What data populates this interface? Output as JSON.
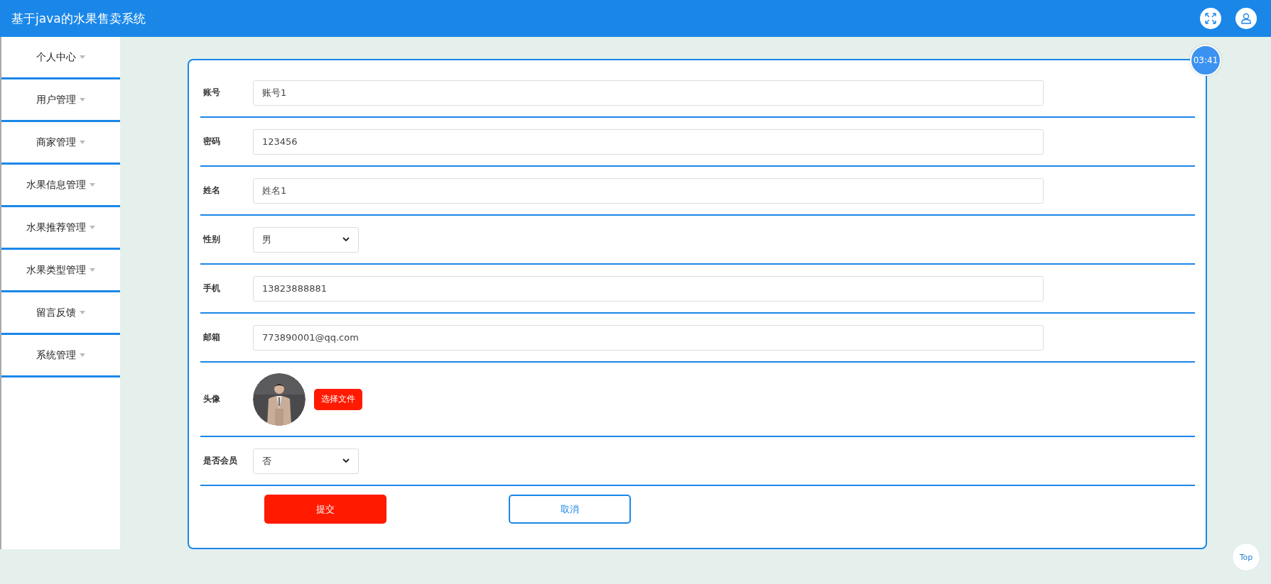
{
  "header": {
    "title": "基于java的水果售卖系统"
  },
  "sidebar": {
    "items": [
      {
        "label": "个人中心"
      },
      {
        "label": "用户管理"
      },
      {
        "label": "商家管理"
      },
      {
        "label": "水果信息管理"
      },
      {
        "label": "水果推荐管理"
      },
      {
        "label": "水果类型管理"
      },
      {
        "label": "留言反馈"
      },
      {
        "label": "系统管理"
      }
    ]
  },
  "timer": "03:41",
  "form": {
    "fields": [
      {
        "kind": "input",
        "label": "账号",
        "value": "账号1"
      },
      {
        "kind": "input",
        "label": "密码",
        "value": "123456"
      },
      {
        "kind": "input",
        "label": "姓名",
        "value": "姓名1"
      },
      {
        "kind": "select",
        "label": "性别",
        "value": "男"
      },
      {
        "kind": "input",
        "label": "手机",
        "value": "13823888881"
      },
      {
        "kind": "input",
        "label": "邮箱",
        "value": "773890001@qq.com"
      },
      {
        "label": "头像",
        "button": "选择文件"
      },
      {
        "kind": "select",
        "label": "是否会员",
        "value": "否"
      }
    ],
    "buttons": [
      {
        "kind": "primary",
        "label": "提交"
      },
      {
        "kind": "outline",
        "label": "取消"
      }
    ]
  },
  "top_button": "Top"
}
